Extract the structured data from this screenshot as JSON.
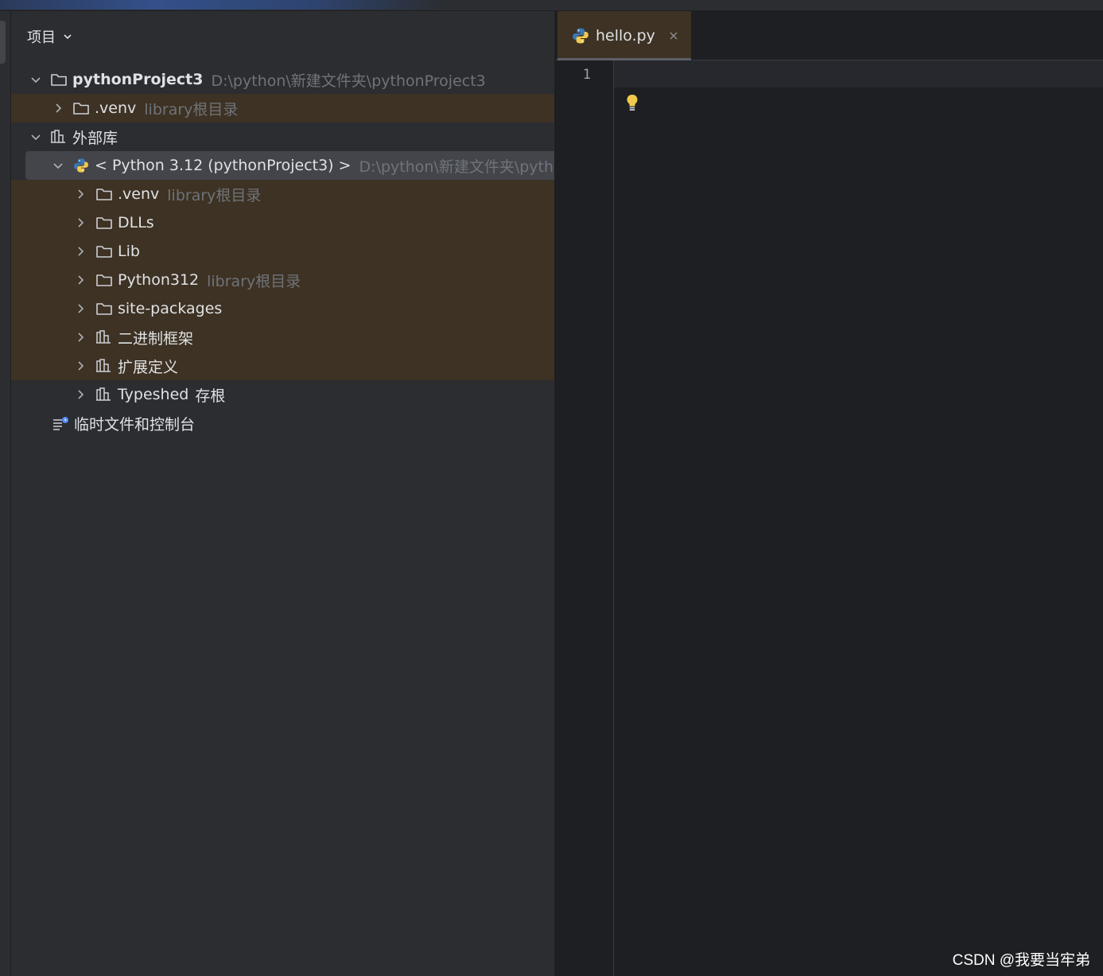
{
  "panel": {
    "title": "项目"
  },
  "tree": {
    "project": {
      "name": "pythonProject3",
      "path": "D:\\python\\新建文件夹\\pythonProject3"
    },
    "venv1": {
      "name": ".venv",
      "hint_en": "library",
      "hint_cn": "根目录"
    },
    "external": {
      "name": "外部库"
    },
    "python_sdk": {
      "name": "< Python 3.12 (pythonProject3) >",
      "path": "D:\\python\\新建文件夹\\python"
    },
    "venv2": {
      "name": ".venv",
      "hint_en": "library",
      "hint_cn": "根目录"
    },
    "dlls": {
      "name": "DLLs"
    },
    "lib": {
      "name": "Lib"
    },
    "python312": {
      "name": "Python312",
      "hint_en": "library",
      "hint_cn": "根目录"
    },
    "site_packages": {
      "name": "site-packages"
    },
    "binary_frameworks": {
      "name": "二进制框架"
    },
    "extended_defs": {
      "name": "扩展定义"
    },
    "typeshed": {
      "name": "Typeshed",
      "suffix": "存根"
    },
    "scratches": {
      "name": "临时文件和控制台"
    }
  },
  "editor": {
    "tab_name": "hello.py",
    "line_numbers": [
      "1"
    ]
  },
  "watermark": "CSDN @我要当牢弟",
  "colors": {
    "panel_bg": "#2b2d30",
    "editor_bg": "#1e1f22",
    "library_row_bg": "#3d3223",
    "selected_row_bg": "#43454a",
    "hint_text": "#6f737a",
    "python_blue": "#3b78b5",
    "python_yellow": "#f2c94c",
    "bulb_yellow": "#f2c94c"
  }
}
